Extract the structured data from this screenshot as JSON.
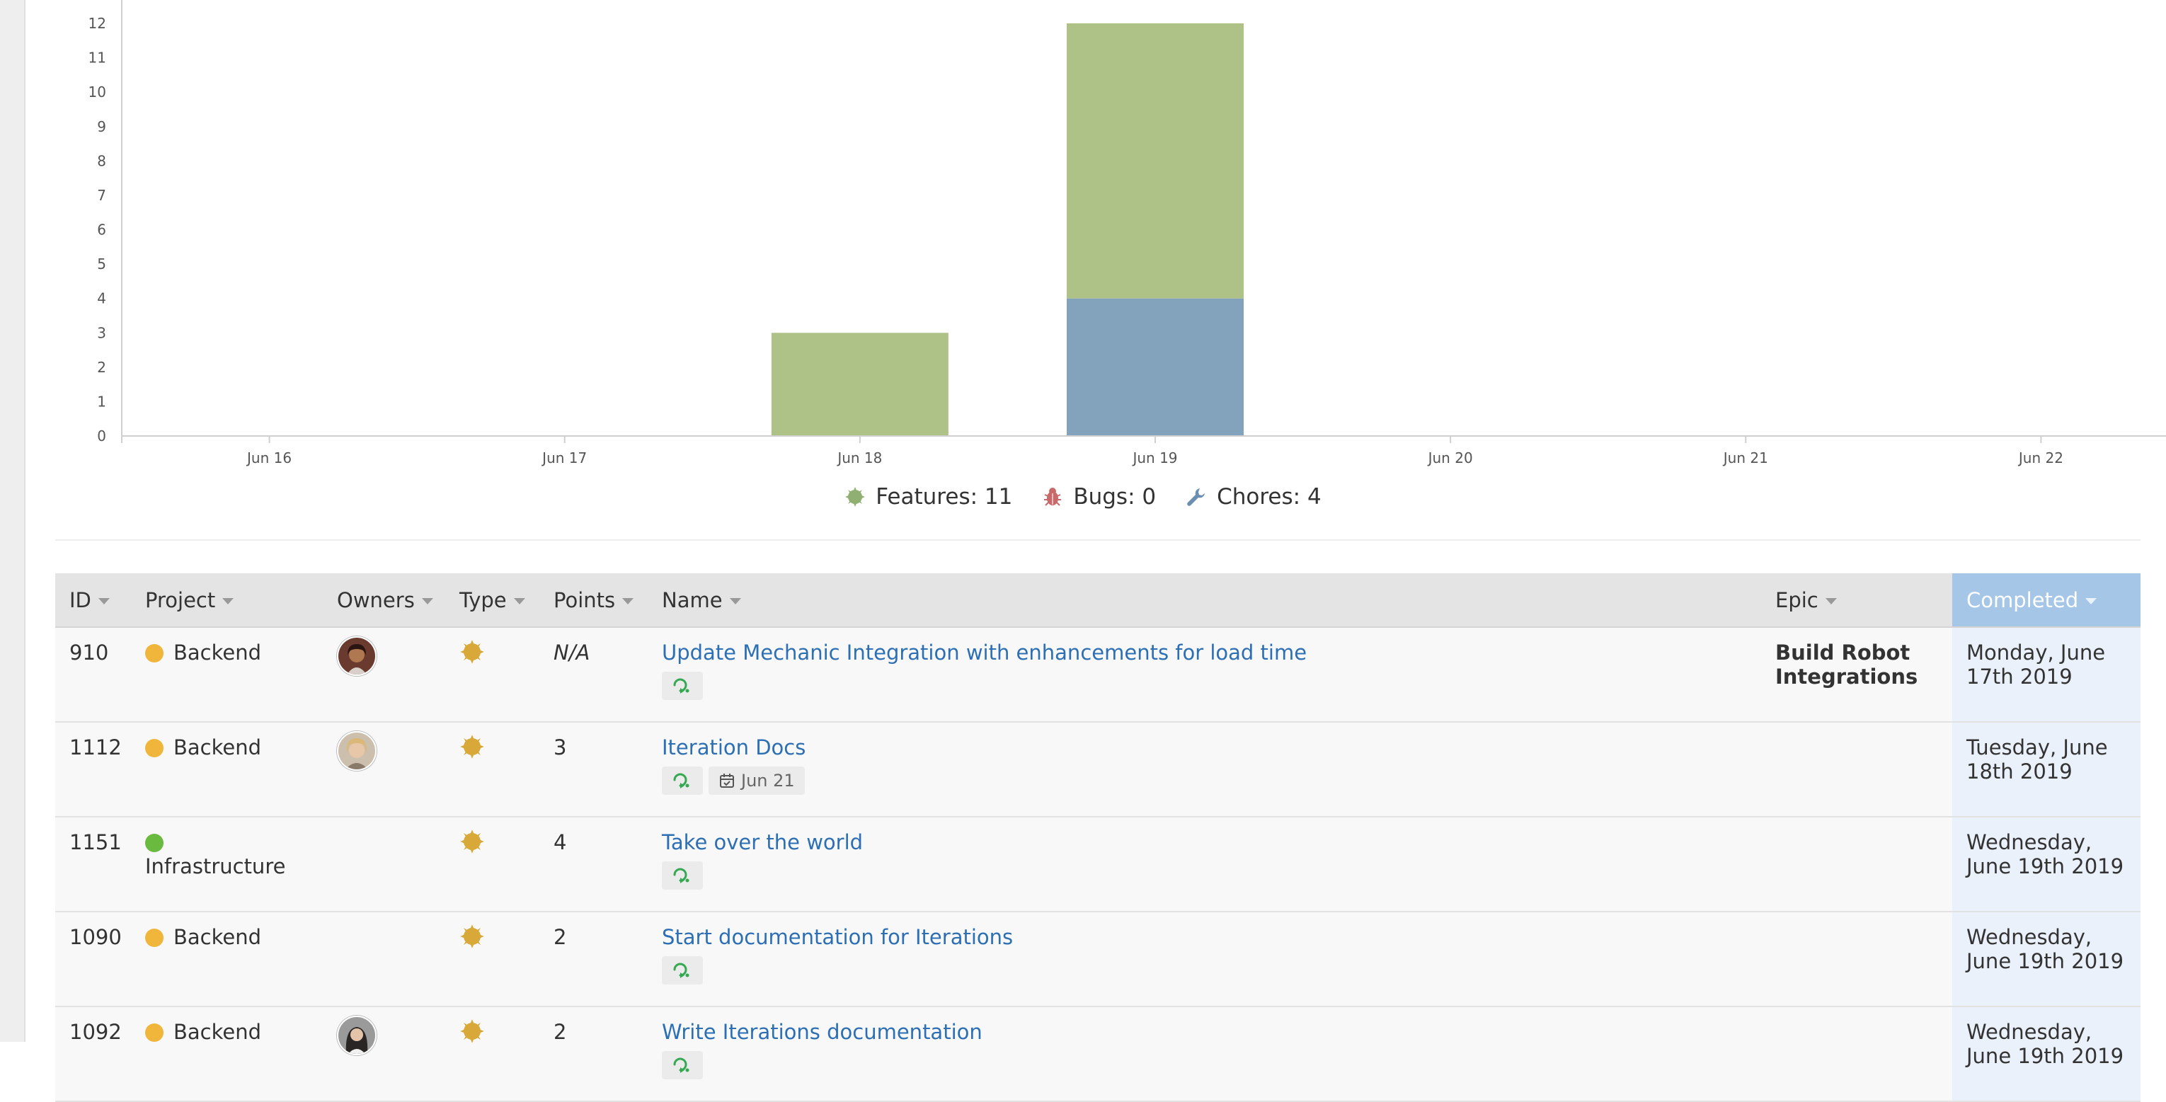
{
  "chart_data": {
    "type": "bar",
    "stacked": true,
    "categories": [
      "Jun 16",
      "Jun 17",
      "Jun 18",
      "Jun 19",
      "Jun 20",
      "Jun 21",
      "Jun 22"
    ],
    "series": [
      {
        "name": "Chores",
        "color": "#83a2bb",
        "values": [
          0,
          0,
          0,
          4,
          0,
          0,
          0
        ]
      },
      {
        "name": "Features",
        "color": "#aec288",
        "values": [
          0,
          0,
          3,
          8,
          0,
          0,
          0
        ]
      }
    ],
    "ylim": [
      0,
      12
    ],
    "yticks": [
      0,
      1,
      2,
      3,
      4,
      5,
      6,
      7,
      8,
      9,
      10,
      11,
      12
    ],
    "grid": false,
    "legend_position": "bottom-center"
  },
  "legend": [
    {
      "icon": "feature-icon",
      "label": "Features: 11",
      "color": "#8fb070"
    },
    {
      "icon": "bug-icon",
      "label": "Bugs: 0",
      "color": "#c96a6a"
    },
    {
      "icon": "wrench-icon",
      "label": "Chores: 4",
      "color": "#6b8fb0"
    }
  ],
  "table": {
    "columns": {
      "id": "ID",
      "project": "Project",
      "owners": "Owners",
      "type": "Type",
      "points": "Points",
      "name": "Name",
      "epic": "Epic",
      "completed": "Completed"
    },
    "rows": [
      {
        "id": "910",
        "project": "Backend",
        "project_color": "#f0b63c",
        "owner": "owner-avatar-dark-hair",
        "type": "feature-icon",
        "points": "N/A",
        "name": "Update Mechanic Integration with enhancements for load time",
        "due": "",
        "epic": "Build Robot Integrations",
        "completed": "Monday, June 17th 2019"
      },
      {
        "id": "1112",
        "project": "Backend",
        "project_color": "#f0b63c",
        "owner": "owner-avatar-light-hair",
        "type": "feature-icon",
        "points": "3",
        "name": "Iteration Docs",
        "due": "Jun 21",
        "epic": "",
        "completed": "Tuesday, June 18th 2019"
      },
      {
        "id": "1151",
        "project": "Infrastructure",
        "project_color": "#6aba3f",
        "owner": "",
        "type": "feature-icon",
        "points": "4",
        "name": "Take over the world",
        "due": "",
        "epic": "",
        "completed": "Wednesday, June 19th 2019"
      },
      {
        "id": "1090",
        "project": "Backend",
        "project_color": "#f0b63c",
        "owner": "",
        "type": "feature-icon",
        "points": "2",
        "name": "Start documentation for Iterations",
        "due": "",
        "epic": "",
        "completed": "Wednesday, June 19th 2019"
      },
      {
        "id": "1092",
        "project": "Backend",
        "project_color": "#f0b63c",
        "owner": "owner-avatar-dark-long-hair",
        "type": "feature-icon",
        "points": "2",
        "name": "Write Iterations documentation",
        "due": "",
        "epic": "",
        "completed": "Wednesday, June 19th 2019"
      }
    ]
  }
}
